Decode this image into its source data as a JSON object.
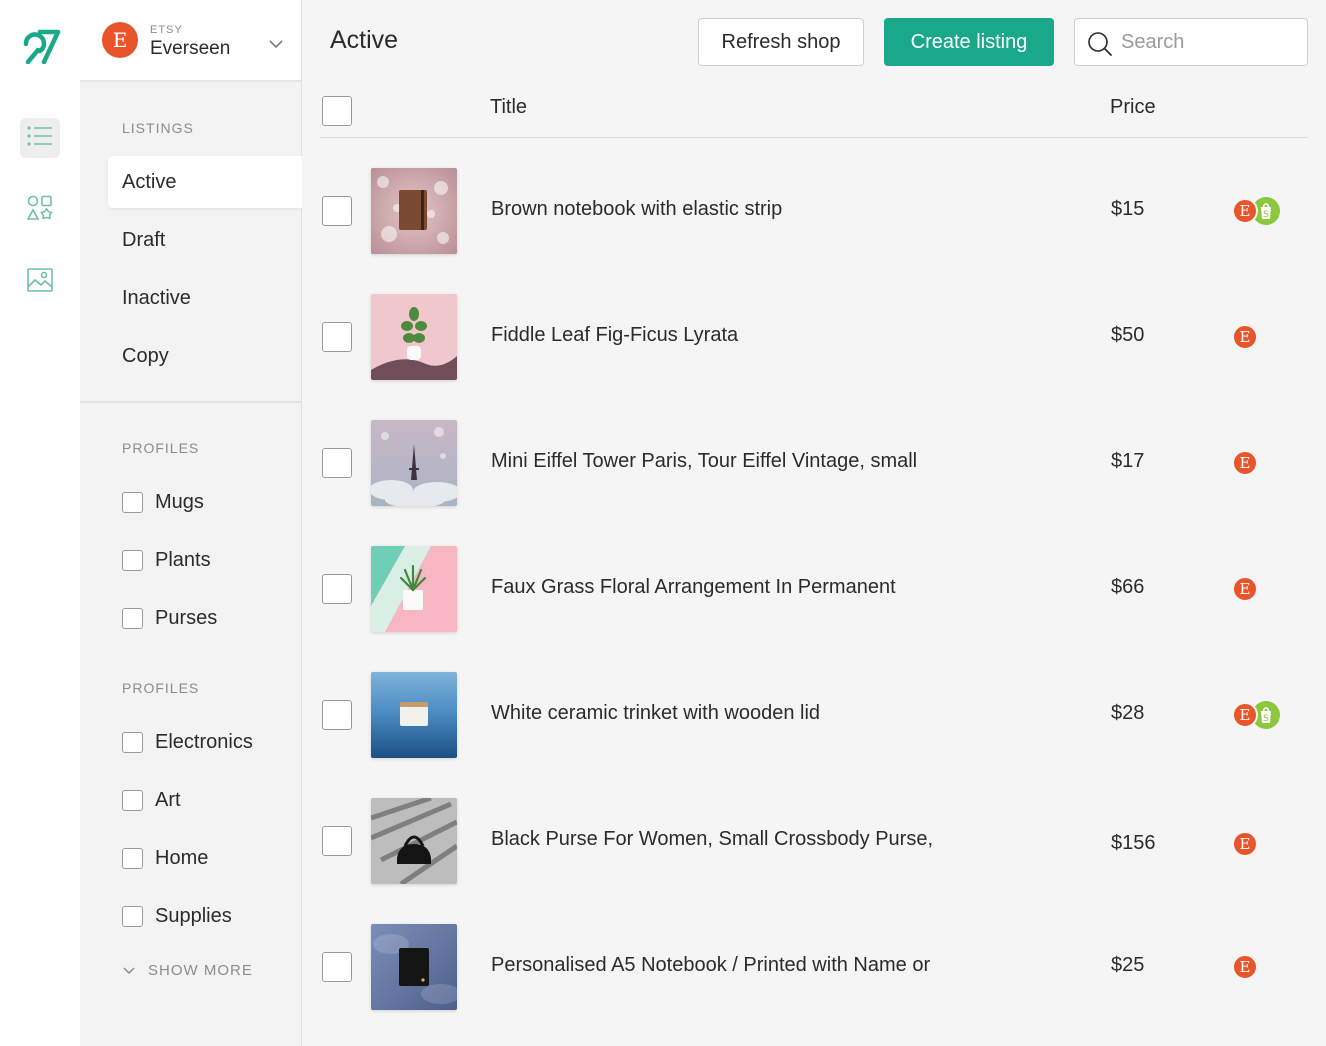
{
  "shop": {
    "platform": "ETSY",
    "name": "Everseen",
    "badge_letter": "E"
  },
  "sidebar": {
    "listings_heading": "LISTINGS",
    "listings": [
      "Active",
      "Draft",
      "Inactive",
      "Copy"
    ],
    "profiles_heading_1": "PROFILES",
    "profiles_1": [
      "Mugs",
      "Plants",
      "Purses"
    ],
    "profiles_heading_2": "PROFILES",
    "profiles_2": [
      "Electronics",
      "Art",
      "Home",
      "Supplies"
    ],
    "show_more": "SHOW MORE"
  },
  "header": {
    "title": "Active",
    "refresh_label": "Refresh shop",
    "create_label": "Create listing",
    "search_placeholder": "Search"
  },
  "table": {
    "col_title": "Title",
    "col_price": "Price",
    "rows": [
      {
        "title": "Brown notebook with elastic strip",
        "price": "$15",
        "etsy": "E",
        "shopify": true
      },
      {
        "title": "Fiddle Leaf Fig-Ficus Lyrata",
        "price": "$50",
        "etsy": "E",
        "shopify": false
      },
      {
        "title": "Mini Eiffel Tower Paris, Tour Eiffel Vintage, small",
        "price": "$17",
        "etsy": "E",
        "shopify": false
      },
      {
        "title": "Faux Grass Floral Arrangement In Permanent",
        "price": "$66",
        "etsy": "E",
        "shopify": false
      },
      {
        "title": "White ceramic trinket with wooden lid",
        "price": "$28",
        "etsy": "E",
        "shopify": true
      },
      {
        "title": "Black Purse For Women, Small Crossbody Purse,",
        "price": "$156",
        "etsy": "E",
        "shopify": false
      },
      {
        "title": "Personalised A5 Notebook / Printed with Name or",
        "price": "$25",
        "etsy": "E",
        "shopify": false
      }
    ]
  },
  "colors": {
    "accent": "#1aa88b",
    "etsy": "#e8552a",
    "shopify": "#8dc63f"
  },
  "icons": {
    "logo": "app-logo-icon",
    "rail": [
      "list-icon",
      "shapes-icon",
      "image-icon"
    ],
    "search": "search-icon"
  }
}
